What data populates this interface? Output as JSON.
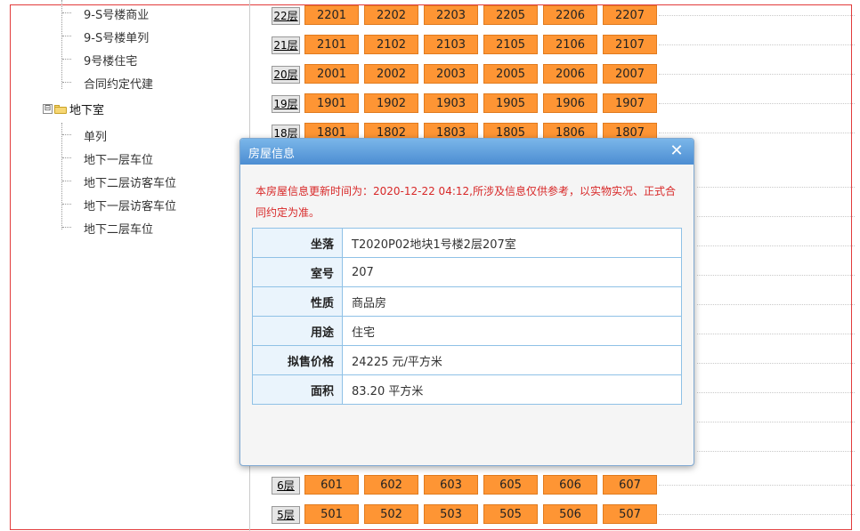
{
  "tree": {
    "items_top": [
      "9-S号楼商业",
      "9-S号楼单列",
      "9号楼住宅",
      "合同约定代建"
    ],
    "folder_expander": "⊟",
    "folder_label": "地下室",
    "items_bottom": [
      "单列",
      "地下一层车位",
      "地下二层访客车位",
      "地下一层访客车位",
      "地下二层车位"
    ]
  },
  "floors": [
    {
      "label": "22层",
      "units": [
        "2201",
        "2202",
        "2203",
        "2205",
        "2206",
        "2207"
      ]
    },
    {
      "label": "21层",
      "units": [
        "2101",
        "2102",
        "2103",
        "2105",
        "2106",
        "2107"
      ]
    },
    {
      "label": "20层",
      "units": [
        "2001",
        "2002",
        "2003",
        "2005",
        "2006",
        "2007"
      ]
    },
    {
      "label": "19层",
      "units": [
        "1901",
        "1902",
        "1903",
        "1905",
        "1906",
        "1907"
      ]
    },
    {
      "label": "18层",
      "units": [
        "1801",
        "1802",
        "1803",
        "1805",
        "1806",
        "1807"
      ]
    },
    {
      "label": "6层",
      "units": [
        "601",
        "602",
        "603",
        "605",
        "606",
        "607"
      ]
    },
    {
      "label": "5层",
      "units": [
        "501",
        "502",
        "503",
        "505",
        "506",
        "507"
      ]
    }
  ],
  "dialog": {
    "title": "房屋信息",
    "close": "✕",
    "notice": "本房屋信息更新时间为：2020-12-22 04:12,所涉及信息仅供参考，以实物实况、正式合同约定为准。",
    "fields": [
      {
        "key": "坐落",
        "value": "T2020P02地块1号楼2层207室"
      },
      {
        "key": "室号",
        "value": "207"
      },
      {
        "key": "性质",
        "value": "商品房"
      },
      {
        "key": "用途",
        "value": "住宅"
      },
      {
        "key": "拟售价格",
        "value": "24225 元/平方米"
      },
      {
        "key": "面积",
        "value": "83.20 平方米"
      }
    ]
  },
  "colors": {
    "unit_bg": "#fe9534",
    "frame_border": "#e23b3b",
    "dialog_head": "#4c8dd2",
    "notice": "#d82828"
  }
}
